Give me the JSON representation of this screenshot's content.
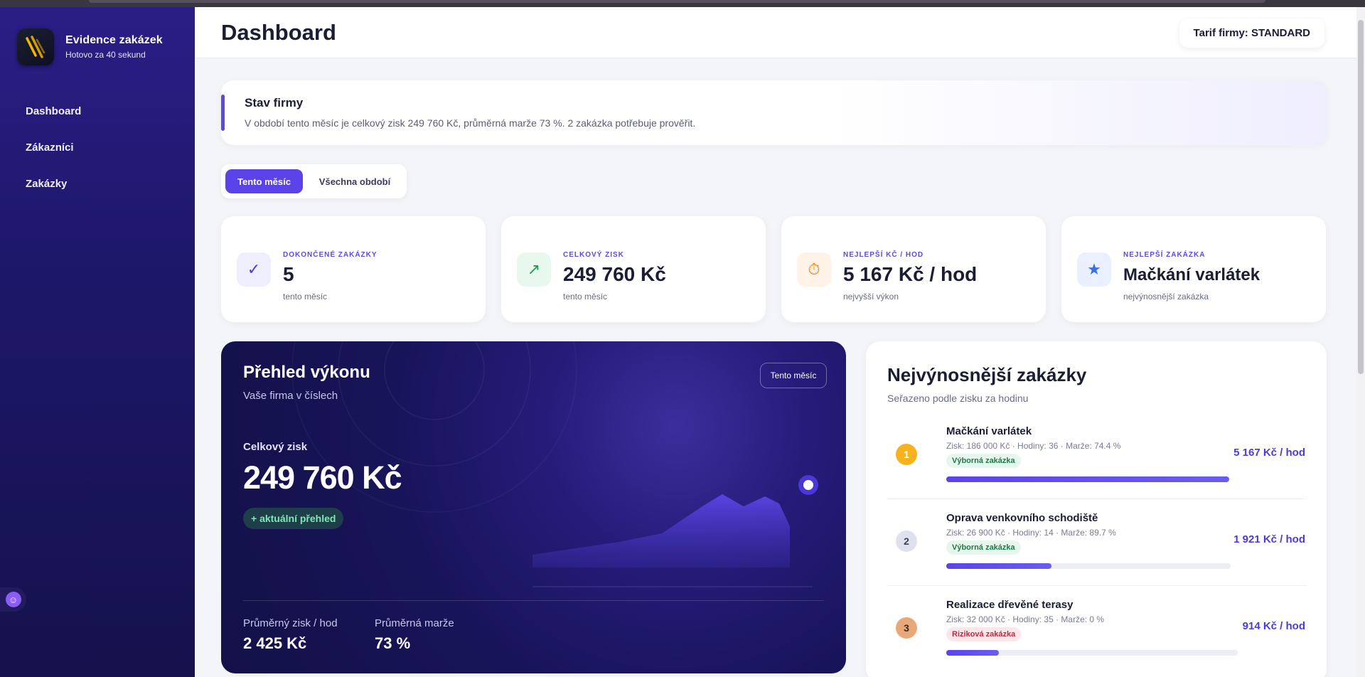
{
  "brand": {
    "title": "Evidence zakázek",
    "subtitle": "Hotovo za 40 sekund"
  },
  "nav": [
    {
      "label": "Dashboard"
    },
    {
      "label": "Zákazníci"
    },
    {
      "label": "Zakázky"
    }
  ],
  "header": {
    "title": "Dashboard",
    "tarif": "Tarif firmy: STANDARD"
  },
  "status": {
    "title": "Stav firmy",
    "text": "V období tento měsíc je celkový zisk 249 760 Kč, průměrná marže 73 %. 2 zakázka potřebuje prověřit."
  },
  "period": {
    "active": "Tento měsíc",
    "inactive": "Všechna období"
  },
  "cards": [
    {
      "label": "DOKONČENÉ ZAKÁZKY",
      "value": "5",
      "sub": "tento měsíc",
      "icon": "check-icon",
      "glyph": "✓"
    },
    {
      "label": "CELKOVÝ ZISK",
      "value": "249 760 Kč",
      "sub": "tento měsíc",
      "icon": "trend-up-icon",
      "glyph": "↗"
    },
    {
      "label": "NEJLEPŠÍ KČ / HOD",
      "value": "5 167 Kč / hod",
      "sub": "nejvyšší výkon",
      "icon": "stopwatch-icon",
      "glyph": "⏱"
    },
    {
      "label": "NEJLEPŠÍ ZAKÁZKA",
      "value": "Mačkání varlátek",
      "sub": "nejvýnosnější zakázka",
      "icon": "star-icon",
      "glyph": "★"
    }
  ],
  "performance": {
    "title": "Přehled výkonu",
    "subtitle": "Vaše firma v číslech",
    "period_button": "Tento měsíc",
    "profit_label": "Celkový zisk",
    "profit_value": "249 760 Kč",
    "badge": "+ aktuální přehled",
    "avg_label": "Průměrný zisk / hod",
    "avg_value": "2 425 Kč",
    "margin_label": "Průměrná marže",
    "margin_value": "73 %"
  },
  "top_jobs": {
    "title": "Nejvýnosnější zakázky",
    "subtitle": "Seřazeno podle zisku za hodinu",
    "items": [
      {
        "rank": "1",
        "name": "Mačkání varlátek",
        "meta": "Zisk: 186 000 Kč · Hodiny: 36 · Marže: 74.4 %",
        "tag": "Výborná zakázka",
        "tag_type": "good",
        "rate": "5 167 Kč / hod",
        "progress": 1.0
      },
      {
        "rank": "2",
        "name": "Oprava venkovního schodiště",
        "meta": "Zisk: 26 900 Kč · Hodiny: 14 · Marže: 89.7 %",
        "tag": "Výborná zakázka",
        "tag_type": "good",
        "rate": "1 921 Kč / hod",
        "progress": 0.37
      },
      {
        "rank": "3",
        "name": "Realizace dřevěné terasy",
        "meta": "Zisk: 32 000 Kč · Hodiny: 35 · Marže: 0 %",
        "tag": "Riziková zakázka",
        "tag_type": "risk",
        "rate": "914 Kč / hod",
        "progress": 0.18
      }
    ]
  },
  "colors": {
    "accent": "#5b43ea",
    "sidebar": "#1d1769",
    "success": "#7ee8b4"
  }
}
